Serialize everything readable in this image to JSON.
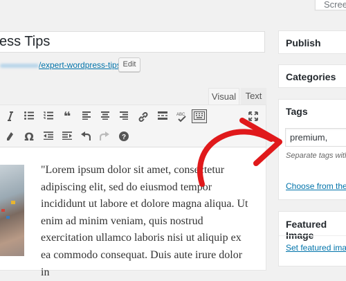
{
  "screen_options": "Screen",
  "post": {
    "title": "ess Tips",
    "permalink_slug": "/expert-wordpress-tips/",
    "edit_button": "Edit"
  },
  "editor": {
    "tab_visual": "Visual",
    "tab_text": "Text",
    "toolbar_row1": [
      "bulleted-list-icon",
      "numbered-list-icon",
      "blockquote-icon",
      "align-left-icon",
      "align-center-icon",
      "align-right-icon",
      "insert-link-icon",
      "read-more-icon",
      "spellcheck-icon",
      "toolbar-toggle-icon",
      "fullscreen-icon"
    ],
    "toolbar_row2": [
      "clear-formatting-icon",
      "special-character-icon",
      "outdent-icon",
      "indent-icon",
      "undo-icon",
      "redo-icon",
      "help-icon"
    ],
    "content": "\"Lorem ipsum dolor sit amet, consectetur adipiscing elit, sed do eiusmod tempor incididunt ut labore et dolore magna aliqua. Ut enim ad minim veniam, quis nostrud exercitation ullamco laboris nisi ut aliquip ex ea commodo consequat. Duis aute irure dolor in"
  },
  "sidebar": {
    "publish_title": "Publish",
    "categories_title": "Categories",
    "tags_title": "Tags",
    "tags_value": "premium,",
    "tags_hint": "Separate tags with",
    "tags_choose_link": "Choose from the m",
    "featured_title": "Featured Image",
    "featured_link": "Set featured imag"
  },
  "colors": {
    "link": "#0073aa",
    "arrow": "#e0191b",
    "background": "#f1f1f1"
  }
}
